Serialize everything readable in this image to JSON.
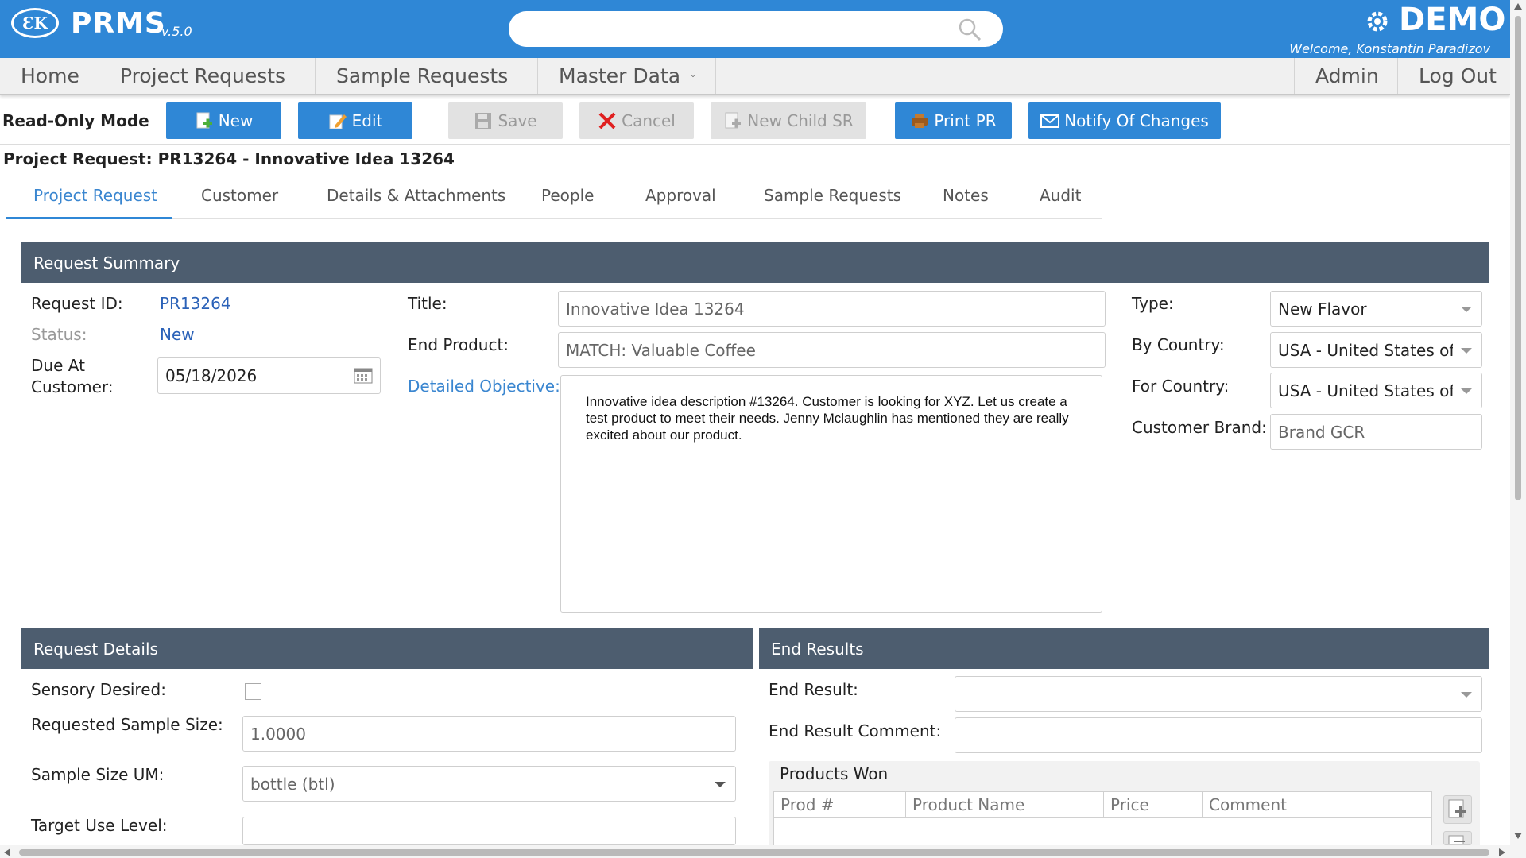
{
  "header": {
    "logo_text": "ƐK",
    "app_name": "PRMS",
    "version": "v.5.0",
    "env_label": "DEMO",
    "welcome": "Welcome, Konstantin Paradizov",
    "search_placeholder": ""
  },
  "nav": {
    "home": "Home",
    "project_requests": "Project Requests",
    "sample_requests": "Sample Requests",
    "master_data": "Master Data",
    "admin": "Admin",
    "logout": "Log Out"
  },
  "toolbar": {
    "mode": "Read-Only Mode",
    "new": "New",
    "edit": "Edit",
    "save": "Save",
    "cancel": "Cancel",
    "new_child_sr": "New Child SR",
    "print_pr": "Print PR",
    "notify": "Notify Of Changes"
  },
  "page_title": "Project Request: PR13264 - Innovative Idea 13264",
  "tabs": [
    "Project Request",
    "Customer",
    "Details & Attachments",
    "People",
    "Approval",
    "Sample Requests",
    "Notes",
    "Audit"
  ],
  "summary": {
    "header": "Request Summary",
    "request_id_label": "Request ID:",
    "request_id": "PR13264",
    "status_label": "Status:",
    "status": "New",
    "due_label_1": "Due At",
    "due_label_2": "Customer:",
    "due_value": "05/18/2026",
    "title_label": "Title:",
    "title_value": "Innovative Idea 13264",
    "end_product_label": "End Product:",
    "end_product_value": "MATCH: Valuable Coffee",
    "objective_label": "Detailed Objective:",
    "objective_value": "Innovative idea description #13264. Customer is looking for XYZ. Let us create a test product to meet their needs. Jenny Mclaughlin has mentioned they are really excited about our product.",
    "type_label": "Type:",
    "type_value": "New Flavor",
    "by_country_label": "By Country:",
    "by_country_value": "USA - United States of A",
    "for_country_label": "For Country:",
    "for_country_value": "USA - United States of A",
    "brand_label": "Customer Brand:",
    "brand_value": "Brand GCR"
  },
  "details": {
    "header": "Request Details",
    "sensory_label": "Sensory Desired:",
    "sensory_checked": false,
    "sample_size_label": "Requested Sample Size:",
    "sample_size_value": "1.0000",
    "um_label": "Sample Size UM:",
    "um_value": "bottle (btl)",
    "target_label": "Target Use Level:",
    "target_value": ""
  },
  "end_results": {
    "header": "End Results",
    "end_result_label": "End Result:",
    "end_result_value": "",
    "comment_label": "End Result Comment:",
    "comment_value": "",
    "products_won_title": "Products Won",
    "columns": [
      "Prod #",
      "Product Name",
      "Price",
      "Comment"
    ]
  },
  "colors": {
    "header_blue": "#2f87d6",
    "panel_header": "#4d5d6f",
    "link": "#2b62b8"
  }
}
